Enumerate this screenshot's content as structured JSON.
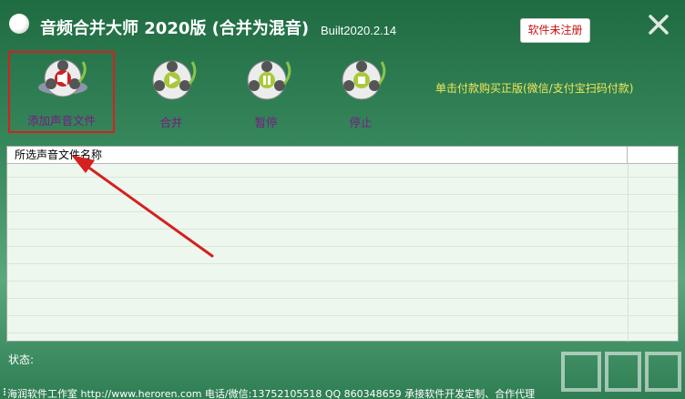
{
  "window": {
    "title": "音频合并大师 2020版 (合并为混音)",
    "version": "Built2020.2.14",
    "register_label": "软件未注册"
  },
  "toolbar": {
    "items": [
      {
        "label": "添加声音文件",
        "icon": "speaker-disc-icon"
      },
      {
        "label": "合并",
        "icon": "play-disc-icon"
      },
      {
        "label": "暂停",
        "icon": "pause-disc-icon"
      },
      {
        "label": "停止",
        "icon": "stop-disc-icon"
      }
    ],
    "promo_link": "单击付款购买正版(微信/支付宝扫码付款)"
  },
  "file_list": {
    "columns": [
      "所选声音文件名称",
      ""
    ]
  },
  "status": {
    "label": "状态:"
  },
  "footer": {
    "text": "海润软件工作室 http://www.heroren.com 电话/微信:13752105518  QQ 860348659 承接软件开发定制、合作代理"
  },
  "colors": {
    "title_text": "#ffffff",
    "toolbar_label": "#7a1a86",
    "promo": "#f2e85a",
    "highlight_box": "#d62020",
    "arrow": "#d62020"
  }
}
